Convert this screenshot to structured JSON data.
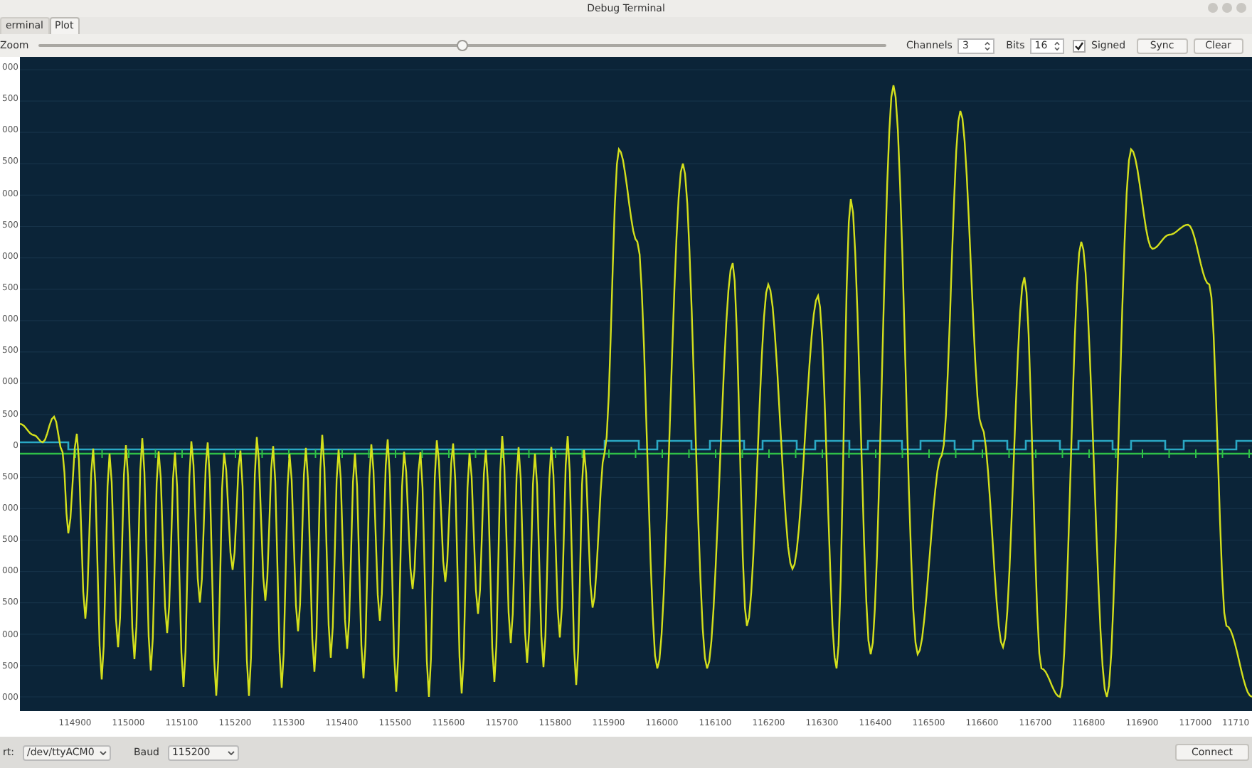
{
  "window": {
    "title": "Debug Terminal"
  },
  "tabs": [
    {
      "label": "erminal",
      "selected": false
    },
    {
      "label": "Plot",
      "selected": true
    }
  ],
  "toolbar": {
    "zoom_label": "Zoom",
    "zoom": {
      "level": 0.5
    },
    "channels_label": "Channels",
    "channels": "3",
    "bits_label": "Bits",
    "bits": "16",
    "signed": {
      "label": "Signed",
      "checked": true
    },
    "buttons": [
      "Sync",
      "Clear"
    ]
  },
  "plot": {
    "y_axis_labels": [
      "000",
      "500",
      "000",
      "500",
      "000",
      "500",
      "000",
      "500",
      "000",
      "500",
      "000",
      "500",
      "0",
      "500",
      "000",
      "500",
      "000",
      "500",
      "000",
      "500",
      "000"
    ],
    "x_axis_labels": [
      "114900",
      "115000",
      "115100",
      "115200",
      "115300",
      "115400",
      "115500",
      "115600",
      "115700",
      "115800",
      "115900",
      "116000",
      "116100",
      "116200",
      "116300",
      "116400",
      "116500",
      "116600",
      "116700",
      "116800",
      "116900",
      "117000",
      "11710"
    ]
  },
  "status_bar": {
    "port_label": "rt:",
    "port": "/dev/ttyACM0",
    "baud_label": "Baud",
    "baud": "115200",
    "connect": "Connect"
  }
}
